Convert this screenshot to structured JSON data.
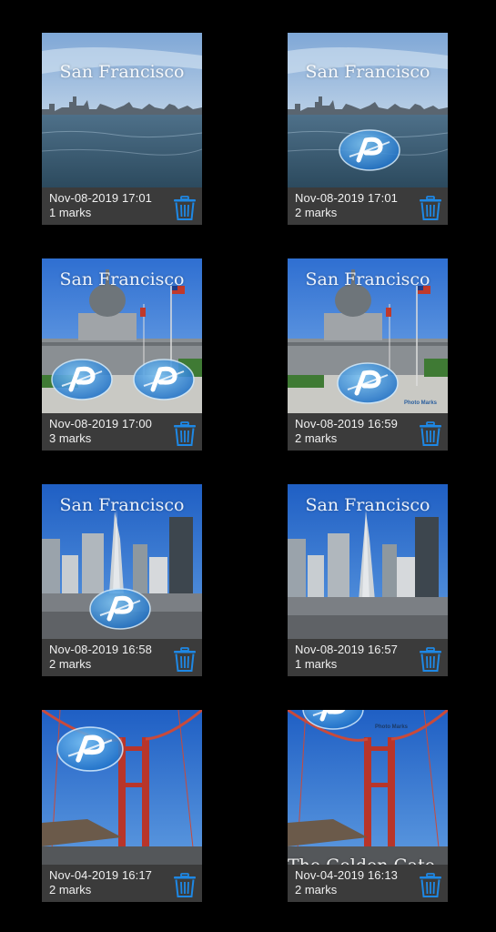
{
  "gallery": {
    "photos": [
      {
        "date": "Nov-08-2019 17:01",
        "marks": "1 marks",
        "caption": "San Francisco",
        "scene": "skyline-bay"
      },
      {
        "date": "Nov-08-2019 17:01",
        "marks": "2 marks",
        "caption": "San Francisco",
        "scene": "skyline-bay"
      },
      {
        "date": "Nov-08-2019 17:00",
        "marks": "3 marks",
        "caption": "San Francisco",
        "scene": "city-hall"
      },
      {
        "date": "Nov-08-2019 16:59",
        "marks": "2 marks",
        "caption": "San Francisco",
        "scene": "city-hall"
      },
      {
        "date": "Nov-08-2019 16:58",
        "marks": "2 marks",
        "caption": "San Francisco",
        "scene": "downtown"
      },
      {
        "date": "Nov-08-2019 16:57",
        "marks": "1 marks",
        "caption": "San Francisco",
        "scene": "downtown"
      },
      {
        "date": "Nov-04-2019 16:17",
        "marks": "2 marks",
        "caption": "",
        "scene": "golden-gate"
      },
      {
        "date": "Nov-04-2019 16:13",
        "marks": "2 marks",
        "caption": "",
        "scene": "golden-gate"
      }
    ],
    "watermark_labels": {
      "photo_marks": "Photo Marks",
      "photo_marks_small": "Photo Marks"
    },
    "bridge_caption_partial": "The Golden Gate",
    "delete_icon": "trash-icon",
    "accent_color": "#1e88e5"
  }
}
